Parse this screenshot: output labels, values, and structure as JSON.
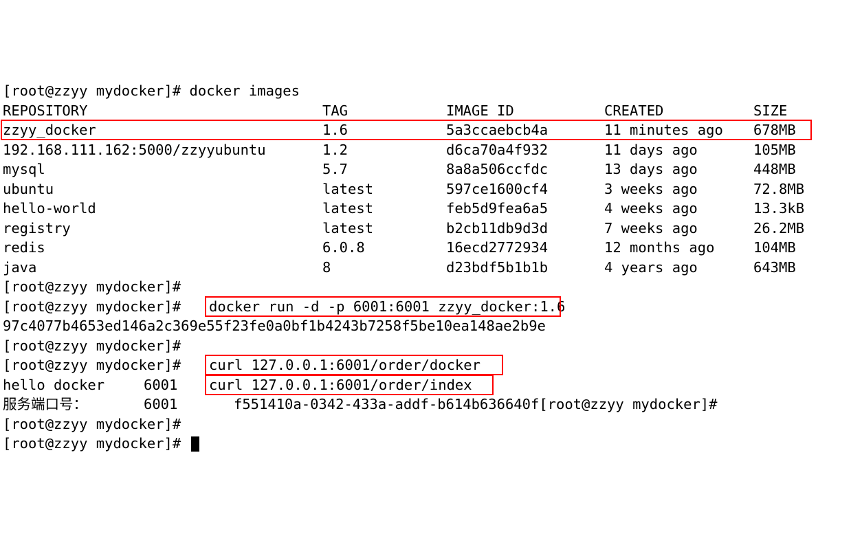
{
  "prompt": "[root@zzyy mydocker]#",
  "cmd_images": "docker images",
  "header": {
    "repo": "REPOSITORY",
    "tag": "TAG",
    "id": "IMAGE ID",
    "created": "CREATED",
    "size": "SIZE"
  },
  "rows": [
    {
      "repo": "zzyy_docker",
      "tag": "1.6",
      "id": "5a3ccaebcb4a",
      "created": "11 minutes ago",
      "size": "678MB"
    },
    {
      "repo": "192.168.111.162:5000/zzyyubuntu",
      "tag": "1.2",
      "id": "d6ca70a4f932",
      "created": "11 days ago",
      "size": "105MB"
    },
    {
      "repo": "mysql",
      "tag": "5.7",
      "id": "8a8a506ccfdc",
      "created": "13 days ago",
      "size": "448MB"
    },
    {
      "repo": "ubuntu",
      "tag": "latest",
      "id": "597ce1600cf4",
      "created": "3 weeks ago",
      "size": "72.8MB"
    },
    {
      "repo": "hello-world",
      "tag": "latest",
      "id": "feb5d9fea6a5",
      "created": "4 weeks ago",
      "size": "13.3kB"
    },
    {
      "repo": "registry",
      "tag": "latest",
      "id": "b2cb11db9d3d",
      "created": "7 weeks ago",
      "size": "26.2MB"
    },
    {
      "repo": "redis",
      "tag": "6.0.8",
      "id": "16ecd2772934",
      "created": "12 months ago",
      "size": "104MB"
    },
    {
      "repo": "java",
      "tag": "8",
      "id": "d23bdf5b1b1b",
      "created": "4 years ago",
      "size": "643MB"
    }
  ],
  "cmd_run": "docker run -d -p 6001:6001 zzyy_docker:1.6",
  "run_output": "97c4077b4653ed146a2c369e55f23fe0a0bf1b4243b7258f5be10ea148ae2b9e",
  "cmd_curl1": "curl 127.0.0.1:6001/order/docker",
  "curl1_out_a": "hello docker",
  "curl1_out_b": "6001",
  "cmd_curl2": "curl 127.0.0.1:6001/order/index",
  "curl2_out_a": "服务端口号：",
  "curl2_out_b": "6001",
  "curl2_out_c": "f551410a-0342-433a-addf-b614b636640f",
  "cols": {
    "repo": 0,
    "tag": 465,
    "id": 645,
    "created": 875,
    "size": 1092
  },
  "highlight_color": "#ff0000"
}
